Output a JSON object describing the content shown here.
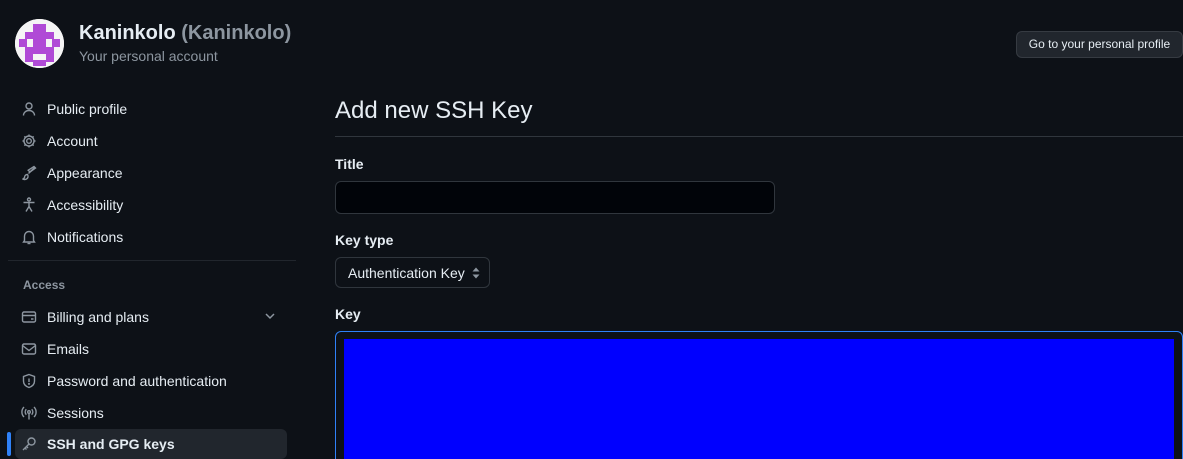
{
  "header": {
    "user_name": "Kaninkolo",
    "user_handle": "(Kaninkolo)",
    "subtitle": "Your personal account",
    "profile_button": "Go to your personal profile"
  },
  "sidebar": {
    "items": [
      {
        "label": "Public profile",
        "icon": "person-icon"
      },
      {
        "label": "Account",
        "icon": "gear-icon"
      },
      {
        "label": "Appearance",
        "icon": "paintbrush-icon"
      },
      {
        "label": "Accessibility",
        "icon": "accessibility-icon"
      },
      {
        "label": "Notifications",
        "icon": "bell-icon"
      }
    ],
    "access_label": "Access",
    "access_items": [
      {
        "label": "Billing and plans",
        "icon": "credit-card-icon"
      },
      {
        "label": "Emails",
        "icon": "mail-icon"
      },
      {
        "label": "Password and authentication",
        "icon": "shield-icon"
      },
      {
        "label": "Sessions",
        "icon": "broadcast-icon"
      },
      {
        "label": "SSH and GPG keys",
        "icon": "key-icon",
        "active": true
      }
    ]
  },
  "main": {
    "title": "Add new SSH Key",
    "title_field_label": "Title",
    "title_field_value": "",
    "key_type_label": "Key type",
    "key_type_value": "Authentication Key",
    "key_label": "Key"
  },
  "colors": {
    "background": "#0d1117",
    "accent": "#2f81f7",
    "key_area": "#0000ff",
    "avatar_pattern": "#b04ad6"
  }
}
